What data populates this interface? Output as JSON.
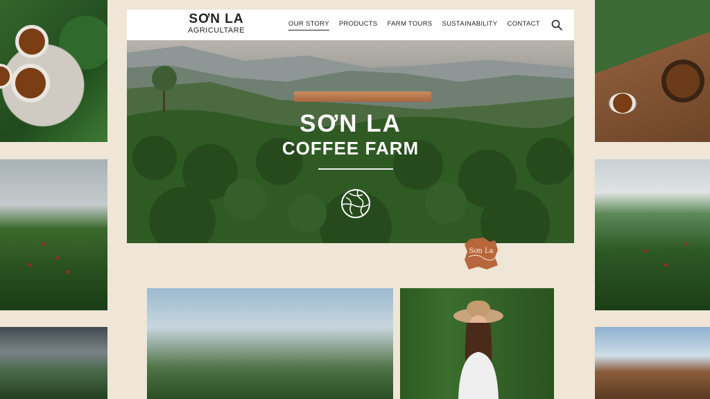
{
  "site": {
    "logo": {
      "line1": "SƠN LA",
      "line2": "AGRICULTARE"
    },
    "nav": [
      {
        "label": "OUR STORY",
        "active": true
      },
      {
        "label": "PRODUCTS",
        "active": false
      },
      {
        "label": "FARM TOURS",
        "active": false
      },
      {
        "label": "SUSTAINABILITY",
        "active": false
      },
      {
        "label": "CONTACT",
        "active": false
      }
    ],
    "search_icon": "search-icon",
    "hero": {
      "title_line1": "SƠN LA",
      "title_line2": "COFFEE FARM",
      "emblem_icon": "globe-icon"
    },
    "badge_text": "Sơn La"
  },
  "colors": {
    "background": "#efe6d7",
    "navbar": "#ffffff",
    "text": "#222222",
    "hero_text": "#ffffff",
    "badge": "#b8663c"
  }
}
